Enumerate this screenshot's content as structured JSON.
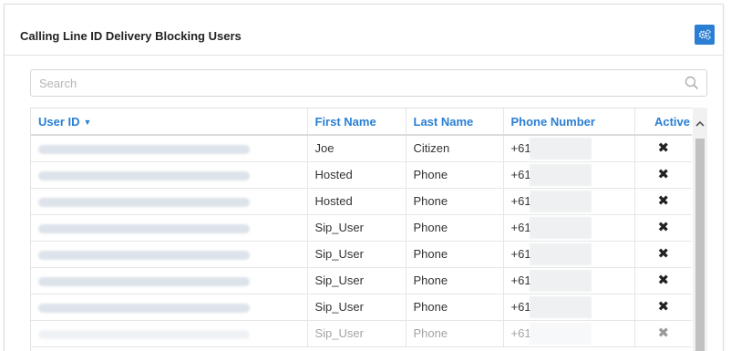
{
  "panel": {
    "title": "Calling Line ID Delivery Blocking Users",
    "settings_icon": "gears-icon",
    "accent": "#2a7fd4"
  },
  "search": {
    "placeholder": "Search",
    "value": ""
  },
  "table": {
    "columns": [
      "User ID",
      "First Name",
      "Last Name",
      "Phone Number",
      "Active"
    ],
    "sort_column": "User ID",
    "rows": [
      {
        "first": "Joe",
        "last": "Citizen",
        "phone_prefix": "+61",
        "active": "✖"
      },
      {
        "first": "Hosted",
        "last": "Phone",
        "phone_prefix": "+61",
        "active": "✖"
      },
      {
        "first": "Hosted",
        "last": "Phone",
        "phone_prefix": "+61",
        "active": "✖"
      },
      {
        "first": "Sip_User",
        "last": "Phone",
        "phone_prefix": "+61",
        "active": "✖"
      },
      {
        "first": "Sip_User",
        "last": "Phone",
        "phone_prefix": "+61",
        "active": "✖"
      },
      {
        "first": "Sip_User",
        "last": "Phone",
        "phone_prefix": "+61",
        "active": "✖"
      },
      {
        "first": "Sip_User",
        "last": "Phone",
        "phone_prefix": "+61",
        "active": "✖"
      },
      {
        "first": "Sip_User",
        "last": "Phone",
        "phone_prefix": "+61",
        "active": "✖"
      }
    ]
  }
}
